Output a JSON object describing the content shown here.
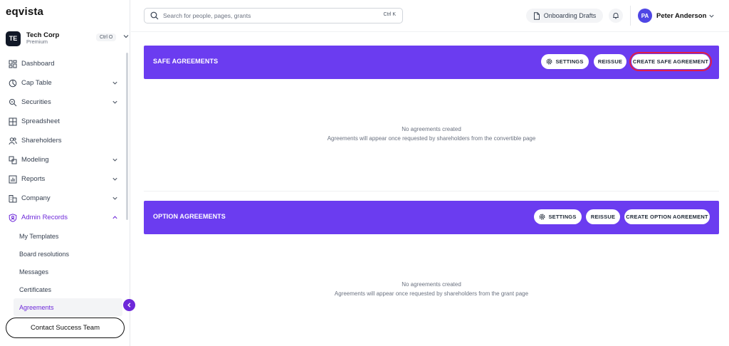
{
  "app": {
    "logo": "eqvista"
  },
  "org": {
    "initials": "TE",
    "name": "Tech Corp",
    "plan": "Premium",
    "shortcut": "Ctrl O"
  },
  "nav": {
    "items": [
      {
        "label": "Dashboard",
        "icon": "dashboard-icon",
        "has_chevron": false
      },
      {
        "label": "Cap Table",
        "icon": "pie-chart-icon",
        "has_chevron": true
      },
      {
        "label": "Securities",
        "icon": "securities-icon",
        "has_chevron": true
      },
      {
        "label": "Spreadsheet",
        "icon": "grid-icon",
        "has_chevron": false
      },
      {
        "label": "Shareholders",
        "icon": "users-icon",
        "has_chevron": false
      },
      {
        "label": "Modeling",
        "icon": "modeling-icon",
        "has_chevron": true
      },
      {
        "label": "Reports",
        "icon": "bar-chart-icon",
        "has_chevron": true
      },
      {
        "label": "Company",
        "icon": "company-icon",
        "has_chevron": true
      },
      {
        "label": "Admin Records",
        "icon": "shield-user-icon",
        "has_chevron": true,
        "expanded": true
      }
    ],
    "sub_items": [
      "My Templates",
      "Board resolutions",
      "Messages",
      "Certificates",
      "Agreements"
    ],
    "active_sub": "Agreements",
    "contact_label": "Contact Success Team"
  },
  "header": {
    "search_placeholder": "Search for people, pages, grants",
    "search_shortcut": "Ctrl K",
    "drafts_label": "Onboarding Drafts",
    "user_initials": "PA",
    "user_name": "Peter Anderson"
  },
  "sections": {
    "safe": {
      "title": "SAFE AGREEMENTS",
      "settings_label": "SETTINGS",
      "reissue_label": "REISSUE",
      "create_label": "CREATE SAFE AGREEMENT",
      "empty_title": "No agreements created",
      "empty_desc": "Agreements will appear once requested by shareholders from the convertible page"
    },
    "option": {
      "title": "OPTION AGREEMENTS",
      "settings_label": "SETTINGS",
      "reissue_label": "REISSUE",
      "create_label": "CREATE OPTION AGREEMENT",
      "empty_title": "No agreements created",
      "empty_desc": "Agreements will appear once requested by shareholders from the grant page"
    }
  },
  "colors": {
    "accent": "#6b3cf0",
    "active_text": "#6d28d9",
    "highlight": "#e11d48"
  }
}
